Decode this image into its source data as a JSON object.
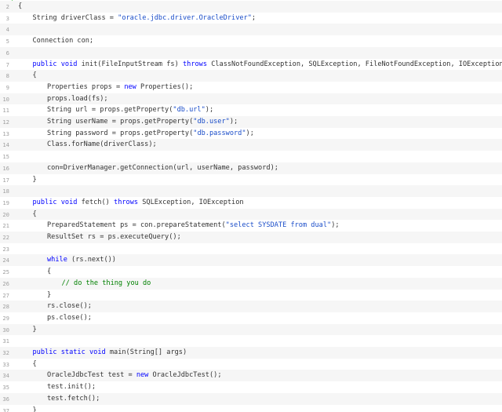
{
  "editor": {
    "lines": [
      {
        "n": "2",
        "indent": 0,
        "parts": [
          {
            "t": "{",
            "c": ""
          }
        ]
      },
      {
        "n": "3",
        "indent": 1,
        "parts": [
          {
            "t": "String driverClass = ",
            "c": ""
          },
          {
            "t": "\"oracle.jdbc.driver.OracleDriver\"",
            "c": "str2"
          },
          {
            "t": ";",
            "c": ""
          }
        ]
      },
      {
        "n": "4",
        "indent": 0,
        "parts": []
      },
      {
        "n": "5",
        "indent": 1,
        "parts": [
          {
            "t": "Connection con;",
            "c": ""
          }
        ]
      },
      {
        "n": "6",
        "indent": 0,
        "parts": []
      },
      {
        "n": "7",
        "indent": 1,
        "parts": [
          {
            "t": "public",
            "c": "kw"
          },
          {
            "t": " ",
            "c": ""
          },
          {
            "t": "void",
            "c": "kw"
          },
          {
            "t": " init(FileInputStream fs) ",
            "c": ""
          },
          {
            "t": "throws",
            "c": "kw"
          },
          {
            "t": " ClassNotFoundException, SQLException, FileNotFoundException, IOException",
            "c": ""
          }
        ]
      },
      {
        "n": "8",
        "indent": 1,
        "parts": [
          {
            "t": "{",
            "c": ""
          }
        ]
      },
      {
        "n": "9",
        "indent": 2,
        "parts": [
          {
            "t": "Properties props = ",
            "c": ""
          },
          {
            "t": "new",
            "c": "kw"
          },
          {
            "t": " Properties();",
            "c": ""
          }
        ]
      },
      {
        "n": "10",
        "indent": 2,
        "parts": [
          {
            "t": "props.load(fs);",
            "c": ""
          }
        ]
      },
      {
        "n": "11",
        "indent": 2,
        "parts": [
          {
            "t": "String url = props.getProperty(",
            "c": ""
          },
          {
            "t": "\"db.url\"",
            "c": "str2"
          },
          {
            "t": ");",
            "c": ""
          }
        ]
      },
      {
        "n": "12",
        "indent": 2,
        "parts": [
          {
            "t": "String userName = props.getProperty(",
            "c": ""
          },
          {
            "t": "\"db.user\"",
            "c": "str2"
          },
          {
            "t": ");",
            "c": ""
          }
        ]
      },
      {
        "n": "13",
        "indent": 2,
        "parts": [
          {
            "t": "String password = props.getProperty(",
            "c": ""
          },
          {
            "t": "\"db.password\"",
            "c": "str2"
          },
          {
            "t": ");",
            "c": ""
          }
        ]
      },
      {
        "n": "14",
        "indent": 2,
        "parts": [
          {
            "t": "Class.forName(driverClass);",
            "c": ""
          }
        ]
      },
      {
        "n": "15",
        "indent": 0,
        "parts": []
      },
      {
        "n": "16",
        "indent": 2,
        "parts": [
          {
            "t": "con=DriverManager.getConnection(url, userName, password);",
            "c": ""
          }
        ]
      },
      {
        "n": "17",
        "indent": 1,
        "parts": [
          {
            "t": "}",
            "c": ""
          }
        ]
      },
      {
        "n": "18",
        "indent": 0,
        "parts": []
      },
      {
        "n": "19",
        "indent": 1,
        "parts": [
          {
            "t": "public",
            "c": "kw"
          },
          {
            "t": " ",
            "c": ""
          },
          {
            "t": "void",
            "c": "kw"
          },
          {
            "t": " fetch() ",
            "c": ""
          },
          {
            "t": "throws",
            "c": "kw"
          },
          {
            "t": " SQLException, IOException",
            "c": ""
          }
        ]
      },
      {
        "n": "20",
        "indent": 1,
        "parts": [
          {
            "t": "{",
            "c": ""
          }
        ]
      },
      {
        "n": "21",
        "indent": 2,
        "parts": [
          {
            "t": "PreparedStatement ps = con.prepareStatement(",
            "c": ""
          },
          {
            "t": "\"select SYSDATE from dual\"",
            "c": "str2"
          },
          {
            "t": ");",
            "c": ""
          }
        ]
      },
      {
        "n": "22",
        "indent": 2,
        "parts": [
          {
            "t": "ResultSet rs = ps.executeQuery();",
            "c": ""
          }
        ]
      },
      {
        "n": "23",
        "indent": 0,
        "parts": []
      },
      {
        "n": "24",
        "indent": 2,
        "parts": [
          {
            "t": "while",
            "c": "kw"
          },
          {
            "t": " (rs.next())",
            "c": ""
          }
        ]
      },
      {
        "n": "25",
        "indent": 2,
        "parts": [
          {
            "t": "{",
            "c": ""
          }
        ]
      },
      {
        "n": "26",
        "indent": 3,
        "parts": [
          {
            "t": "// do the thing you do",
            "c": "cm"
          }
        ]
      },
      {
        "n": "27",
        "indent": 2,
        "parts": [
          {
            "t": "}",
            "c": ""
          }
        ]
      },
      {
        "n": "28",
        "indent": 2,
        "parts": [
          {
            "t": "rs.close();",
            "c": ""
          }
        ]
      },
      {
        "n": "29",
        "indent": 2,
        "parts": [
          {
            "t": "ps.close();",
            "c": ""
          }
        ]
      },
      {
        "n": "30",
        "indent": 1,
        "parts": [
          {
            "t": "}",
            "c": ""
          }
        ]
      },
      {
        "n": "31",
        "indent": 0,
        "parts": []
      },
      {
        "n": "32",
        "indent": 1,
        "parts": [
          {
            "t": "public",
            "c": "kw"
          },
          {
            "t": " ",
            "c": ""
          },
          {
            "t": "static",
            "c": "kw"
          },
          {
            "t": " ",
            "c": ""
          },
          {
            "t": "void",
            "c": "kw"
          },
          {
            "t": " main(String[] args)",
            "c": ""
          }
        ]
      },
      {
        "n": "33",
        "indent": 1,
        "parts": [
          {
            "t": "{",
            "c": ""
          }
        ]
      },
      {
        "n": "34",
        "indent": 2,
        "parts": [
          {
            "t": "OracleJdbcTest test = ",
            "c": ""
          },
          {
            "t": "new",
            "c": "kw"
          },
          {
            "t": " OracleJdbcTest();",
            "c": ""
          }
        ]
      },
      {
        "n": "35",
        "indent": 2,
        "parts": [
          {
            "t": "test.init();",
            "c": ""
          }
        ]
      },
      {
        "n": "36",
        "indent": 2,
        "parts": [
          {
            "t": "test.fetch();",
            "c": ""
          }
        ]
      },
      {
        "n": "37",
        "indent": 1,
        "parts": [
          {
            "t": "}",
            "c": ""
          }
        ]
      }
    ]
  }
}
